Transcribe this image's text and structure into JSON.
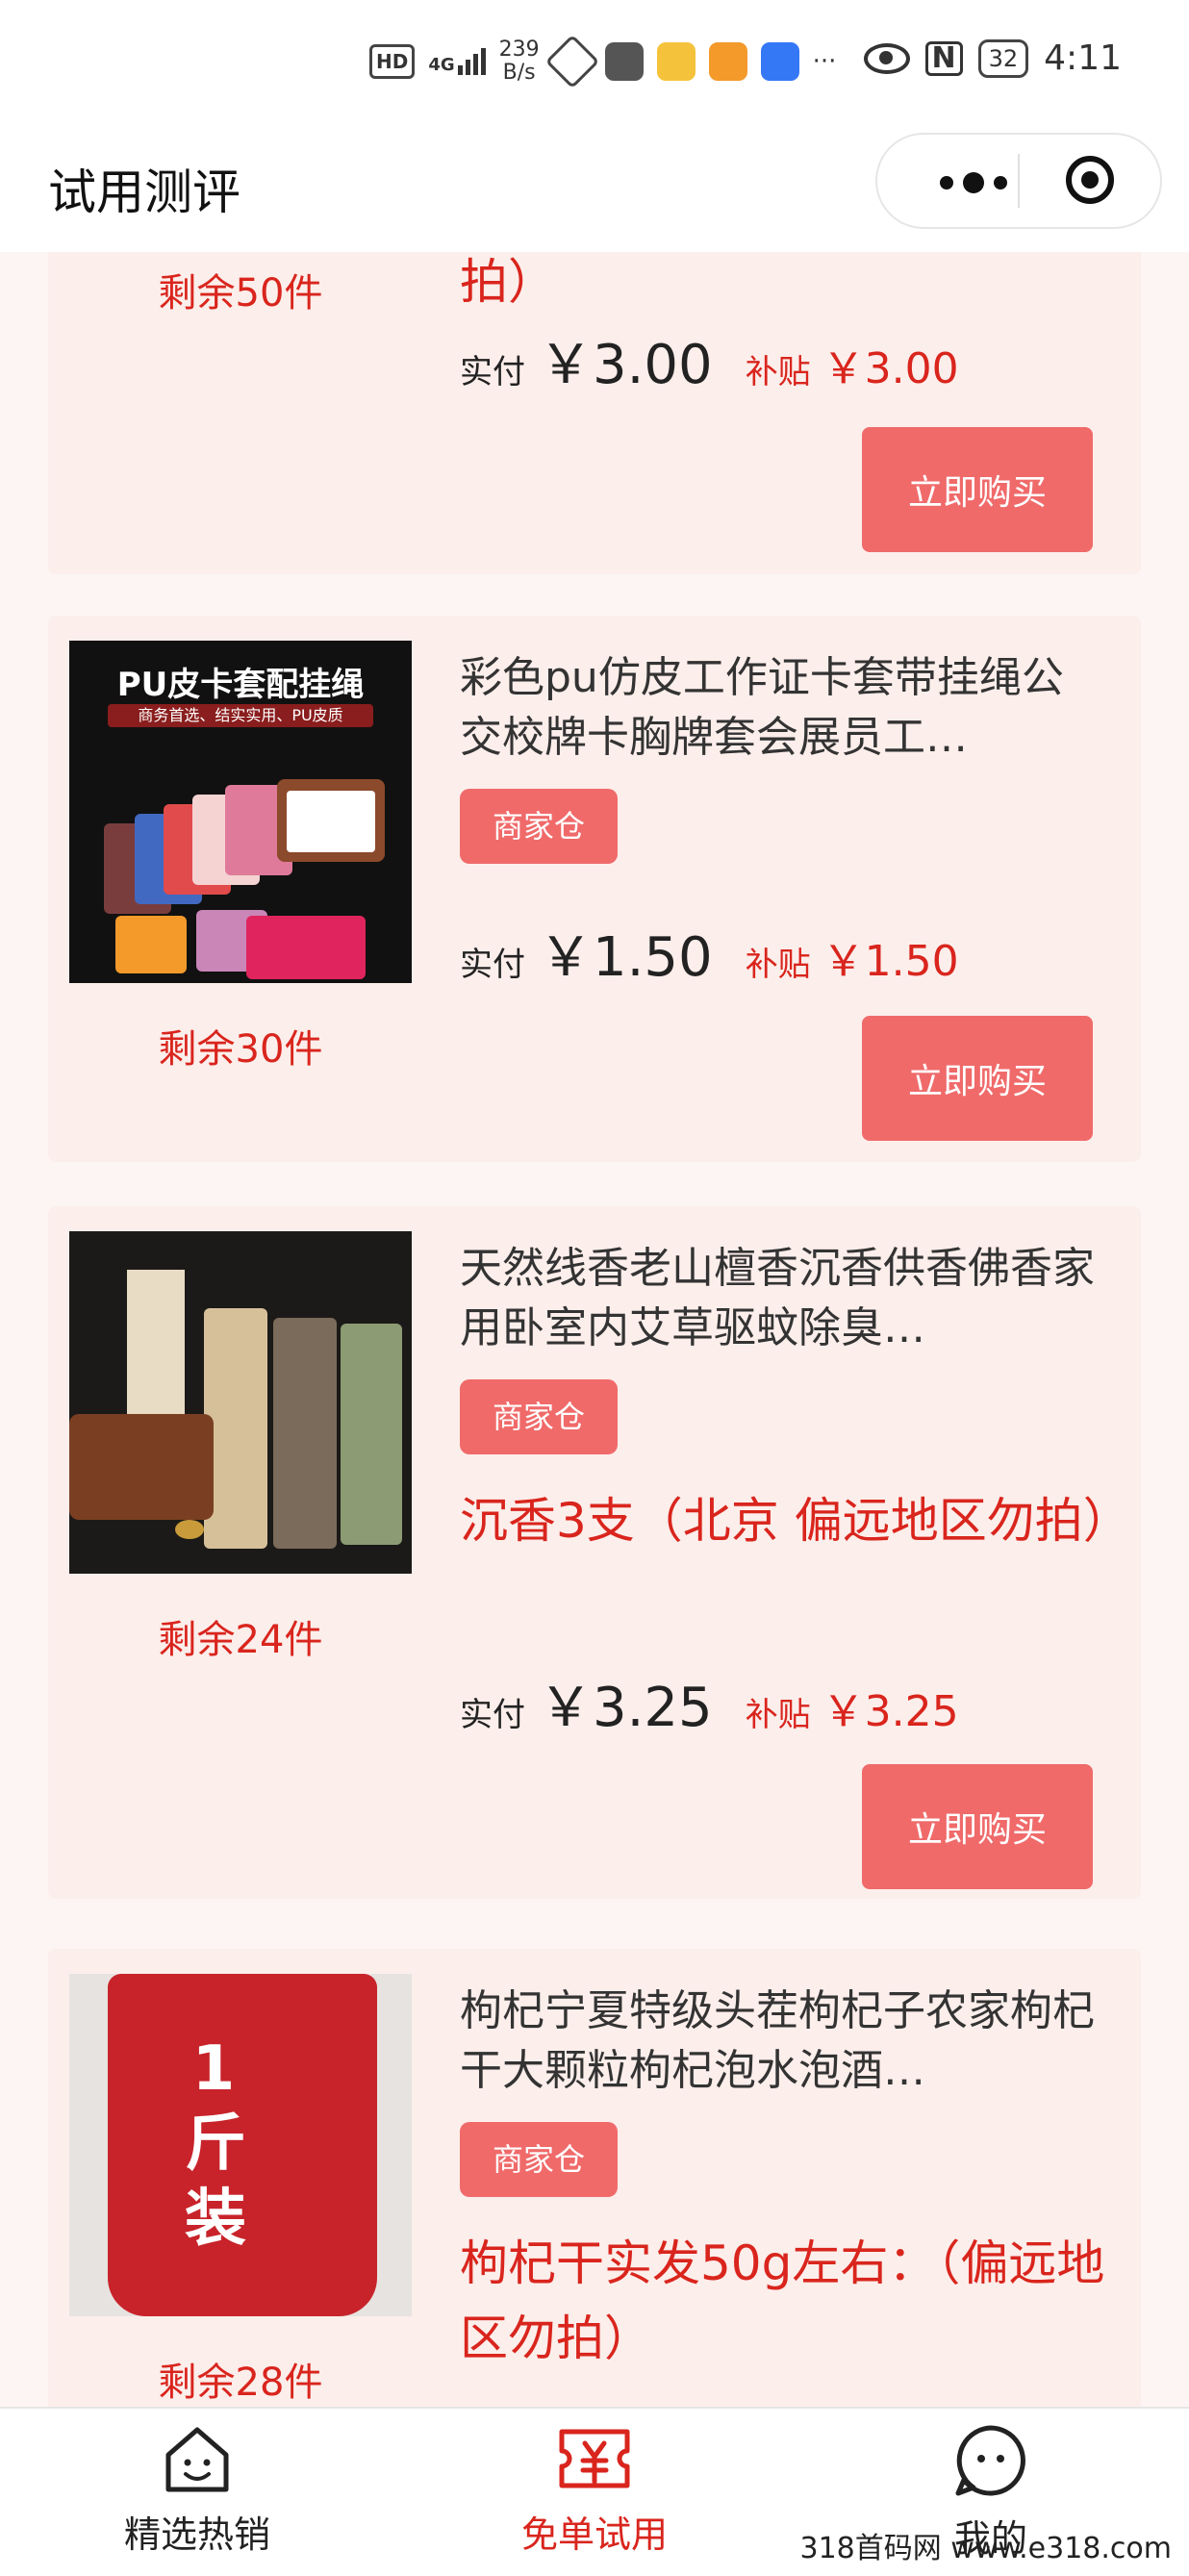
{
  "status_bar": {
    "network": "HD",
    "signal": "4G",
    "speed_value": "239",
    "speed_unit": "B/s",
    "more": "···",
    "nfc": "N",
    "battery": "32",
    "time": "4:11"
  },
  "navbar": {
    "title": "试用测评"
  },
  "colors": {
    "accent": "#f06a6a",
    "price_red": "#d9251d",
    "card_bg": "#fceeeb"
  },
  "products": [
    {
      "spec": "拍）",
      "remain": "剩余50件",
      "paid_label": "实付",
      "paid": "￥3.00",
      "subsidy_label": "补贴",
      "subsidy": "￥3.00",
      "buy_label": "立即购买"
    },
    {
      "image_text": "PU皮卡套配挂绳",
      "image_subtext": "商务首选、结实实用、PU皮质",
      "title": "彩色pu仿皮工作证卡套带挂绳公交校牌卡胸牌套会展员工…",
      "tag": "商家仓",
      "remain": "剩余30件",
      "paid_label": "实付",
      "paid": "￥1.50",
      "subsidy_label": "补贴",
      "subsidy": "￥1.50",
      "buy_label": "立即购买"
    },
    {
      "title": "天然线香老山檀香沉香供香佛香家用卧室内艾草驱蚊除臭…",
      "tag": "商家仓",
      "spec": "沉香3支（北京 偏远地区勿拍）",
      "remain": "剩余24件",
      "paid_label": "实付",
      "paid": "￥3.25",
      "subsidy_label": "补贴",
      "subsidy": "￥3.25",
      "buy_label": "立即购买"
    },
    {
      "image_text": "1斤装",
      "title": "枸杞宁夏特级头茬枸杞子农家枸杞干大颗粒枸杞泡水泡酒…",
      "tag": "商家仓",
      "spec": "枸杞干实发50g左右：（偏远地区勿拍）",
      "remain": "剩余28件"
    }
  ],
  "tabbar": {
    "items": [
      {
        "label": "精选热销",
        "icon": "house-smile-icon"
      },
      {
        "label": "免单试用",
        "icon": "coupon-yen-icon",
        "active": true
      },
      {
        "label": "我的",
        "icon": "face-bubble-icon"
      }
    ],
    "active_color": "#d9251d"
  },
  "watermark": "318首码网 www.e318.com"
}
